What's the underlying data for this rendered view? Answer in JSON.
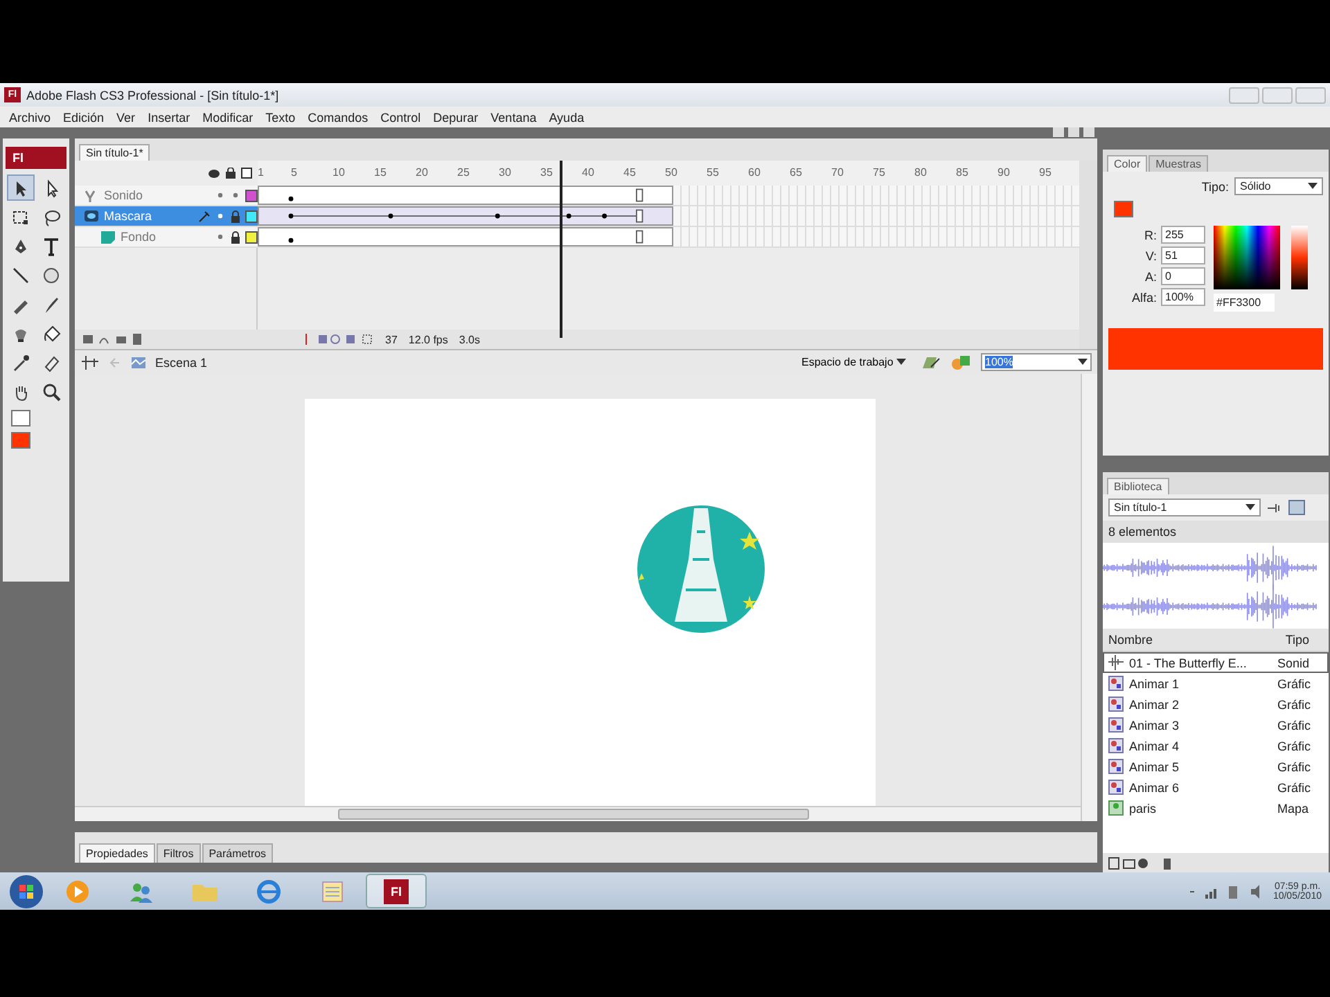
{
  "window": {
    "title": "Adobe Flash CS3 Professional - [Sin título-1*]",
    "logo": "Fl"
  },
  "menu": [
    "Archivo",
    "Edición",
    "Ver",
    "Insertar",
    "Modificar",
    "Texto",
    "Comandos",
    "Control",
    "Depurar",
    "Ventana",
    "Ayuda"
  ],
  "tools_panel": {
    "logo": "Fl",
    "tools": [
      {
        "kind": "selection",
        "selected": true
      },
      {
        "kind": "subselection",
        "selected": false
      },
      {
        "kind": "transform",
        "selected": false
      },
      {
        "kind": "lasso",
        "selected": false
      },
      {
        "kind": "pen",
        "selected": false
      },
      {
        "kind": "text",
        "selected": false
      },
      {
        "kind": "line",
        "selected": false
      },
      {
        "kind": "oval",
        "selected": false
      },
      {
        "kind": "pencil",
        "selected": false
      },
      {
        "kind": "brush",
        "selected": false
      },
      {
        "kind": "ink",
        "selected": false
      },
      {
        "kind": "bucket",
        "selected": false
      },
      {
        "kind": "eyedropper",
        "selected": false
      },
      {
        "kind": "eraser",
        "selected": false
      },
      {
        "kind": "hand",
        "selected": false
      },
      {
        "kind": "zoom",
        "selected": false
      }
    ]
  },
  "document": {
    "tab": "Sin título-1*",
    "timeline": {
      "frame_numbers": [
        "1",
        "5",
        "10",
        "15",
        "20",
        "25",
        "30",
        "35",
        "40",
        "45",
        "50",
        "55",
        "60",
        "65",
        "70",
        "75",
        "80",
        "85",
        "90",
        "95"
      ],
      "layers": [
        {
          "name": "Sonido",
          "kind": "sound",
          "selected": false,
          "locked": false,
          "color": "#d050d0"
        },
        {
          "name": "Mascara",
          "kind": "mask",
          "selected": true,
          "locked": true,
          "color": "#40e8f8",
          "children": [
            {
              "name": "Fondo",
              "kind": "masked",
              "selected": false,
              "locked": true,
              "color": "#f0f040"
            }
          ]
        }
      ],
      "current_frame": "37",
      "frame_rate": "12.0 fps",
      "elapsed_time": "3.0s"
    },
    "edit_bar": {
      "scene": "Escena 1",
      "workspace": "Espacio de trabajo",
      "zoom": "100%"
    },
    "properties_tabs": [
      {
        "label": "Propiedades",
        "selected": true
      },
      {
        "label": "Filtros",
        "selected": false
      },
      {
        "label": "Parámetros",
        "selected": false
      }
    ]
  },
  "color_panel": {
    "tabs": [
      {
        "label": "Color",
        "selected": true
      },
      {
        "label": "Muestras",
        "selected": false
      }
    ],
    "type_label": "Tipo:",
    "type": "Sólido",
    "channels": [
      {
        "label": "R:",
        "value": "255"
      },
      {
        "label": "V:",
        "value": "51"
      },
      {
        "label": "A:",
        "value": "0"
      },
      {
        "label": "Alfa:",
        "value": "100%"
      }
    ],
    "hex": "#FF3300"
  },
  "library": {
    "tab": "Biblioteca",
    "document": "Sin título-1",
    "count": "8 elementos",
    "columns": [
      "Nombre",
      "Tipo"
    ],
    "items": [
      {
        "name": "01 - The Butterfly E...",
        "type": "Sonid",
        "kind": "sound",
        "selected": true
      },
      {
        "name": "Animar 1",
        "type": "Gráfic",
        "kind": "graphic",
        "selected": false
      },
      {
        "name": "Animar 2",
        "type": "Gráfic",
        "kind": "graphic",
        "selected": false
      },
      {
        "name": "Animar 3",
        "type": "Gráfic",
        "kind": "graphic",
        "selected": false
      },
      {
        "name": "Animar 4",
        "type": "Gráfic",
        "kind": "graphic",
        "selected": false
      },
      {
        "name": "Animar 5",
        "type": "Gráfic",
        "kind": "graphic",
        "selected": false
      },
      {
        "name": "Animar 6",
        "type": "Gráfic",
        "kind": "graphic",
        "selected": false
      },
      {
        "name": "paris",
        "type": "Mapa",
        "kind": "bitmap",
        "selected": false
      }
    ]
  },
  "taskbar": {
    "apps": [
      {
        "kind": "media",
        "selected": false
      },
      {
        "kind": "people",
        "selected": false
      },
      {
        "kind": "folder",
        "selected": false
      },
      {
        "kind": "browser",
        "selected": false
      },
      {
        "kind": "notes",
        "selected": false
      },
      {
        "kind": "flash",
        "label": "Fl",
        "selected": true
      }
    ],
    "time": "07:59 p.m.",
    "date": "10/05/2010"
  }
}
